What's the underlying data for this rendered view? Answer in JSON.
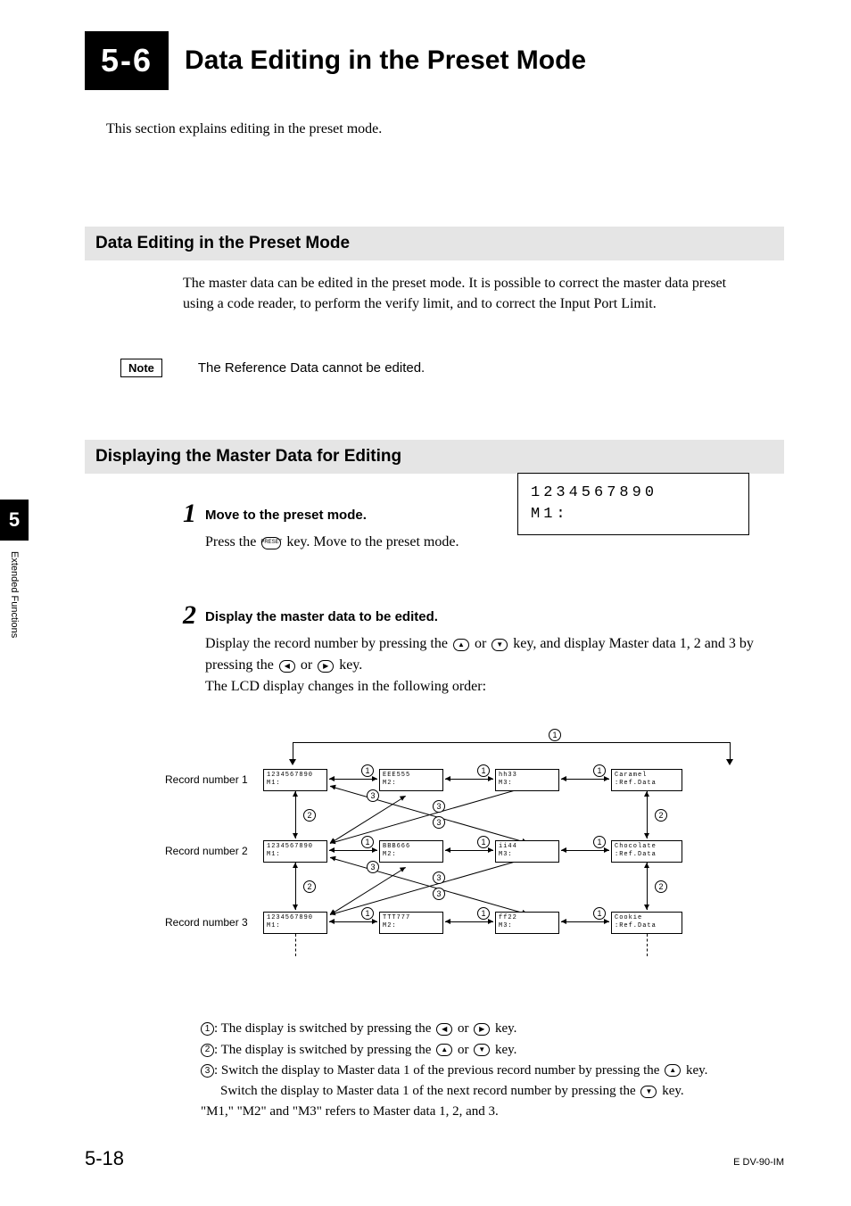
{
  "chapterBadge": "5-6",
  "mainTitle": "Data Editing in the Preset Mode",
  "intro": "This section explains editing in the preset mode.",
  "section1": {
    "heading": "Data Editing in the Preset Mode",
    "body": "The master data can be edited in the preset mode. It is possible to correct the master data preset using a code reader, to perform the verify limit, and to correct the Input Port Limit.",
    "noteLabel": "Note",
    "noteText": "The Reference Data cannot be edited."
  },
  "section2": {
    "heading": "Displaying the Master Data for Editing",
    "step1": {
      "num": "1",
      "title": "Move to the preset mode.",
      "body_pre": "Press the ",
      "keyLabel": "PRESET",
      "body_post": " key. Move to the preset mode.",
      "lcd_line1": "1234567890",
      "lcd_line2": "M1:"
    },
    "step2": {
      "num": "2",
      "title": "Display the master data to be edited.",
      "body_a": "Display the record number by pressing the ",
      "body_b": " or ",
      "body_c": " key, and display Master data 1, 2 and 3 by pressing the ",
      "body_d": " or ",
      "body_e": " key.",
      "body_f": "The LCD display changes in the following order:"
    }
  },
  "diagram": {
    "rowLabels": [
      "Record number 1",
      "Record number 2",
      "Record number 3"
    ],
    "cells": [
      [
        {
          "l1": "1234567890",
          "l2": "M1:"
        },
        {
          "l1": "EEE555",
          "l2": "M2:"
        },
        {
          "l1": "hh33",
          "l2": "M3:"
        },
        {
          "l1": "Caramel",
          "l2": "    :Ref.Data"
        }
      ],
      [
        {
          "l1": "1234567890",
          "l2": "M1:"
        },
        {
          "l1": "BBB666",
          "l2": "M2:"
        },
        {
          "l1": "ii44",
          "l2": "M3:"
        },
        {
          "l1": "Chocolate",
          "l2": "    :Ref.Data"
        }
      ],
      [
        {
          "l1": "1234567890",
          "l2": "M1:"
        },
        {
          "l1": "TTT777",
          "l2": "M2:"
        },
        {
          "l1": "ff22",
          "l2": "M3:"
        },
        {
          "l1": "Cookie",
          "l2": "    :Ref.Data"
        }
      ]
    ],
    "circ1": "1",
    "circ2": "2",
    "circ3": "3"
  },
  "legend": {
    "l1_pre": ": The display is switched by pressing the ",
    "l1_mid": " or ",
    "l1_post": " key.",
    "l2_pre": ": The display is switched by pressing the ",
    "l2_mid": " or ",
    "l2_post": " key.",
    "l3_pre": ": Switch the display to Master data 1 of the previous record number by pressing the ",
    "l3_post": " key.",
    "l3b_pre": "Switch the display to Master data 1 of the next record number by pressing the ",
    "l3b_post": " key.",
    "l4": "\"M1,\" \"M2\" and \"M3\" refers to Master data 1, 2, and 3."
  },
  "sideTab": {
    "num": "5",
    "text": "Extended Functions"
  },
  "footer": {
    "page": "5-18",
    "docId": "E DV-90-IM"
  }
}
